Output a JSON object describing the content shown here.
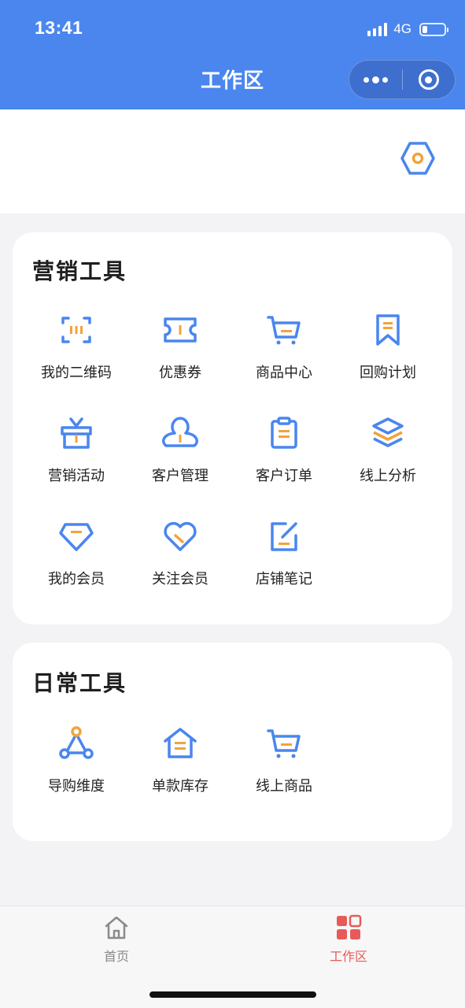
{
  "status": {
    "time": "13:41",
    "network": "4G",
    "battery_pct": 15
  },
  "header": {
    "title": "工作区"
  },
  "sections": [
    {
      "title": "营销工具",
      "items": [
        {
          "label": "我的二维码",
          "icon": "qrcode-icon"
        },
        {
          "label": "优惠券",
          "icon": "ticket-icon"
        },
        {
          "label": "商品中心",
          "icon": "cart-icon"
        },
        {
          "label": "回购计划",
          "icon": "bookmark-icon"
        },
        {
          "label": "营销活动",
          "icon": "gift-icon"
        },
        {
          "label": "客户管理",
          "icon": "user-icon"
        },
        {
          "label": "客户订单",
          "icon": "clipboard-icon"
        },
        {
          "label": "线上分析",
          "icon": "layers-icon"
        },
        {
          "label": "我的会员",
          "icon": "diamond-icon"
        },
        {
          "label": "关注会员",
          "icon": "heart-icon"
        },
        {
          "label": "店铺笔记",
          "icon": "edit-icon"
        }
      ]
    },
    {
      "title": "日常工具",
      "items": [
        {
          "label": "导购维度",
          "icon": "network-icon"
        },
        {
          "label": "单款库存",
          "icon": "house-icon"
        },
        {
          "label": "线上商品",
          "icon": "cart-icon"
        }
      ]
    }
  ],
  "tabbar": {
    "items": [
      {
        "label": "首页",
        "icon": "home-icon",
        "active": false
      },
      {
        "label": "工作区",
        "icon": "grid-icon",
        "active": true
      }
    ]
  },
  "colors": {
    "primary": "#4a86ee",
    "accent": "#f2a33a",
    "active_tab": "#e85a5a",
    "inactive_tab": "#8a8a8a"
  }
}
